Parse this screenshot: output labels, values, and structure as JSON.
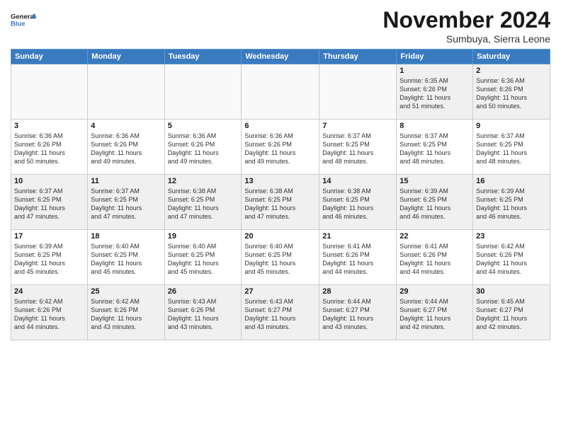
{
  "logo": {
    "line1": "General",
    "line2": "Blue"
  },
  "title": "November 2024",
  "subtitle": "Sumbuya, Sierra Leone",
  "days_of_week": [
    "Sunday",
    "Monday",
    "Tuesday",
    "Wednesday",
    "Thursday",
    "Friday",
    "Saturday"
  ],
  "weeks": [
    [
      {
        "day": "",
        "info": ""
      },
      {
        "day": "",
        "info": ""
      },
      {
        "day": "",
        "info": ""
      },
      {
        "day": "",
        "info": ""
      },
      {
        "day": "",
        "info": ""
      },
      {
        "day": "1",
        "info": "Sunrise: 6:35 AM\nSunset: 6:26 PM\nDaylight: 11 hours\nand 51 minutes."
      },
      {
        "day": "2",
        "info": "Sunrise: 6:36 AM\nSunset: 6:26 PM\nDaylight: 11 hours\nand 50 minutes."
      }
    ],
    [
      {
        "day": "3",
        "info": "Sunrise: 6:36 AM\nSunset: 6:26 PM\nDaylight: 11 hours\nand 50 minutes."
      },
      {
        "day": "4",
        "info": "Sunrise: 6:36 AM\nSunset: 6:26 PM\nDaylight: 11 hours\nand 49 minutes."
      },
      {
        "day": "5",
        "info": "Sunrise: 6:36 AM\nSunset: 6:26 PM\nDaylight: 11 hours\nand 49 minutes."
      },
      {
        "day": "6",
        "info": "Sunrise: 6:36 AM\nSunset: 6:26 PM\nDaylight: 11 hours\nand 49 minutes."
      },
      {
        "day": "7",
        "info": "Sunrise: 6:37 AM\nSunset: 6:25 PM\nDaylight: 11 hours\nand 48 minutes."
      },
      {
        "day": "8",
        "info": "Sunrise: 6:37 AM\nSunset: 6:25 PM\nDaylight: 11 hours\nand 48 minutes."
      },
      {
        "day": "9",
        "info": "Sunrise: 6:37 AM\nSunset: 6:25 PM\nDaylight: 11 hours\nand 48 minutes."
      }
    ],
    [
      {
        "day": "10",
        "info": "Sunrise: 6:37 AM\nSunset: 6:25 PM\nDaylight: 11 hours\nand 47 minutes."
      },
      {
        "day": "11",
        "info": "Sunrise: 6:37 AM\nSunset: 6:25 PM\nDaylight: 11 hours\nand 47 minutes."
      },
      {
        "day": "12",
        "info": "Sunrise: 6:38 AM\nSunset: 6:25 PM\nDaylight: 11 hours\nand 47 minutes."
      },
      {
        "day": "13",
        "info": "Sunrise: 6:38 AM\nSunset: 6:25 PM\nDaylight: 11 hours\nand 47 minutes."
      },
      {
        "day": "14",
        "info": "Sunrise: 6:38 AM\nSunset: 6:25 PM\nDaylight: 11 hours\nand 46 minutes."
      },
      {
        "day": "15",
        "info": "Sunrise: 6:39 AM\nSunset: 6:25 PM\nDaylight: 11 hours\nand 46 minutes."
      },
      {
        "day": "16",
        "info": "Sunrise: 6:39 AM\nSunset: 6:25 PM\nDaylight: 11 hours\nand 46 minutes."
      }
    ],
    [
      {
        "day": "17",
        "info": "Sunrise: 6:39 AM\nSunset: 6:25 PM\nDaylight: 11 hours\nand 45 minutes."
      },
      {
        "day": "18",
        "info": "Sunrise: 6:40 AM\nSunset: 6:25 PM\nDaylight: 11 hours\nand 45 minutes."
      },
      {
        "day": "19",
        "info": "Sunrise: 6:40 AM\nSunset: 6:25 PM\nDaylight: 11 hours\nand 45 minutes."
      },
      {
        "day": "20",
        "info": "Sunrise: 6:40 AM\nSunset: 6:25 PM\nDaylight: 11 hours\nand 45 minutes."
      },
      {
        "day": "21",
        "info": "Sunrise: 6:41 AM\nSunset: 6:26 PM\nDaylight: 11 hours\nand 44 minutes."
      },
      {
        "day": "22",
        "info": "Sunrise: 6:41 AM\nSunset: 6:26 PM\nDaylight: 11 hours\nand 44 minutes."
      },
      {
        "day": "23",
        "info": "Sunrise: 6:42 AM\nSunset: 6:26 PM\nDaylight: 11 hours\nand 44 minutes."
      }
    ],
    [
      {
        "day": "24",
        "info": "Sunrise: 6:42 AM\nSunset: 6:26 PM\nDaylight: 11 hours\nand 44 minutes."
      },
      {
        "day": "25",
        "info": "Sunrise: 6:42 AM\nSunset: 6:26 PM\nDaylight: 11 hours\nand 43 minutes."
      },
      {
        "day": "26",
        "info": "Sunrise: 6:43 AM\nSunset: 6:26 PM\nDaylight: 11 hours\nand 43 minutes."
      },
      {
        "day": "27",
        "info": "Sunrise: 6:43 AM\nSunset: 6:27 PM\nDaylight: 11 hours\nand 43 minutes."
      },
      {
        "day": "28",
        "info": "Sunrise: 6:44 AM\nSunset: 6:27 PM\nDaylight: 11 hours\nand 43 minutes."
      },
      {
        "day": "29",
        "info": "Sunrise: 6:44 AM\nSunset: 6:27 PM\nDaylight: 11 hours\nand 42 minutes."
      },
      {
        "day": "30",
        "info": "Sunrise: 6:45 AM\nSunset: 6:27 PM\nDaylight: 11 hours\nand 42 minutes."
      }
    ]
  ]
}
